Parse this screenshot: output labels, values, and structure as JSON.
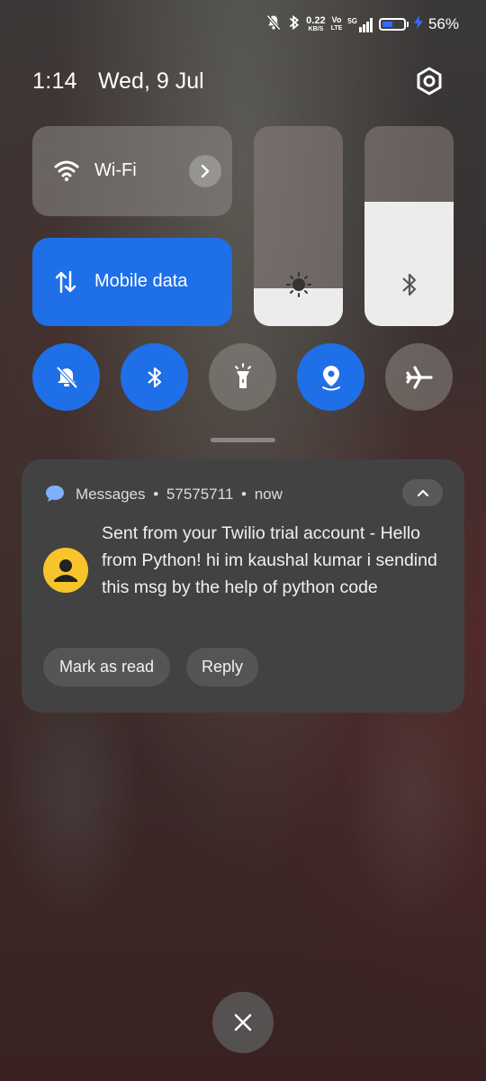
{
  "status_bar": {
    "net_speed_value": "0.22",
    "net_speed_unit": "KB/S",
    "volte_top": "Vo",
    "volte_bottom": "LTE",
    "network_type": "5G",
    "battery_level": 0.56,
    "battery_percent": "56%",
    "icons": [
      "mute-icon",
      "bluetooth-icon",
      "signal-icon",
      "battery-icon",
      "charging-icon"
    ]
  },
  "header": {
    "time": "1:14",
    "date": "Wed, 9 Jul"
  },
  "quick_settings": {
    "wifi_label": "Wi-Fi",
    "mobile_data_label": "Mobile data",
    "brightness_level": 0.19,
    "bluetooth_level": 0.62,
    "toggles": [
      {
        "name": "silent",
        "icon": "bell-off-icon",
        "active": true
      },
      {
        "name": "bluetooth",
        "icon": "bluetooth-icon",
        "active": true
      },
      {
        "name": "flashlight",
        "icon": "flashlight-icon",
        "active": false
      },
      {
        "name": "location",
        "icon": "location-icon",
        "active": true
      },
      {
        "name": "airplane",
        "icon": "airplane-icon",
        "active": false
      }
    ]
  },
  "notification": {
    "app": "Messages",
    "sender": "57575711",
    "time": "now",
    "separator": "•",
    "body": "Sent from your Twilio trial account - Hello from Python! hi im kaushal kumar i sendind this msg by the help of python code",
    "actions": {
      "mark_as_read": "Mark as read",
      "reply": "Reply"
    }
  },
  "colors": {
    "accent": "#1f6fe8",
    "avatar": "#f7c52b"
  }
}
